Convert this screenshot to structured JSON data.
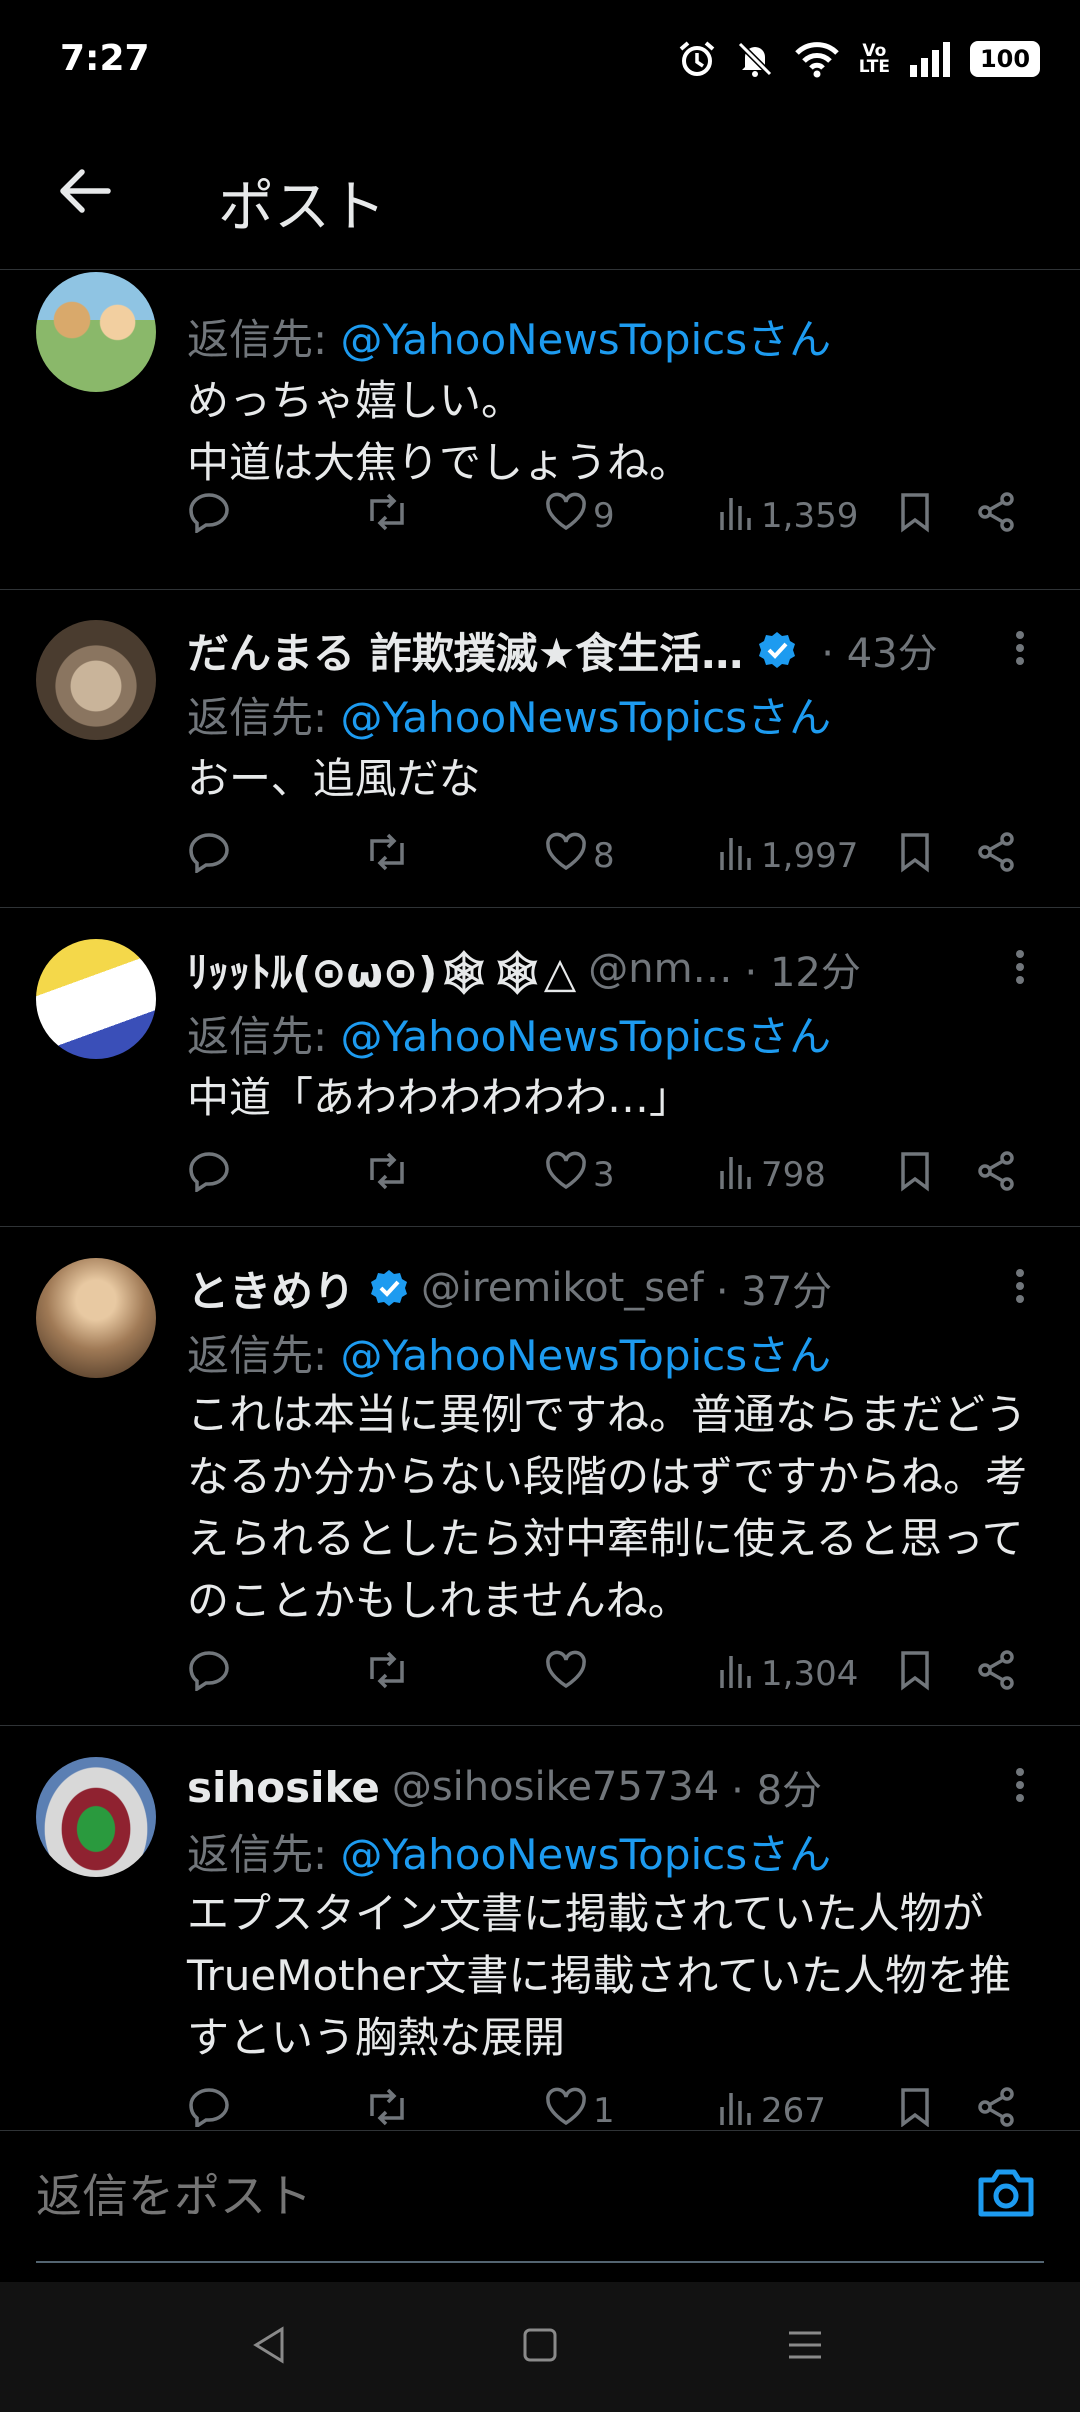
{
  "status": {
    "time": "7:27",
    "battery": "100",
    "volte": "Vo\nLTE"
  },
  "header": {
    "title": "ポスト"
  },
  "reply_prefix": "返信先: ",
  "mention": "@YahooNewsTopicsさん",
  "tweets": [
    {
      "name": "",
      "handle": "",
      "time": "",
      "body": "めっちゃ嬉しい。\n中道は大焦りでしょうね。",
      "replies": "",
      "retweets": "",
      "likes": "9",
      "views": "1,359",
      "verified": true
    },
    {
      "name": "だんまる 詐欺撲滅★食生活…",
      "handle": "",
      "time": "· 43分",
      "body": "おー、追風だな",
      "replies": "",
      "retweets": "",
      "likes": "8",
      "views": "1,997",
      "verified": true
    },
    {
      "name": "ﾘｯｯﾄﾙ(⊙ω⊙)🕸🕸△",
      "handle": "@nm…",
      "time": "· 12分",
      "body": "中道「あわわわわわわ…」",
      "replies": "",
      "retweets": "",
      "likes": "3",
      "views": "798",
      "verified": false
    },
    {
      "name": "ときめり",
      "handle": "@iremikot_sef",
      "time": "· 37分",
      "body": "これは本当に異例ですね。普通ならまだどうなるか分からない段階のはずですからね。考えられるとしたら対中牽制に使えると思ってのことかもしれませんね。",
      "replies": "",
      "retweets": "",
      "likes": "",
      "views": "1,304",
      "verified": true
    },
    {
      "name": "sihosike",
      "handle": "@sihosike75734",
      "time": "· 8分",
      "body": "エプスタイン文書に掲載されていた人物がTrueMother文書に掲載されていた人物を推すという胸熱な展開",
      "replies": "",
      "retweets": "",
      "likes": "1",
      "views": "267",
      "verified": false
    }
  ],
  "compose": {
    "placeholder": "返信をポスト"
  },
  "colors": {
    "accent": "#1d9bf0",
    "muted": "#71767b",
    "text": "#e7e9ea",
    "background": "#000000"
  }
}
